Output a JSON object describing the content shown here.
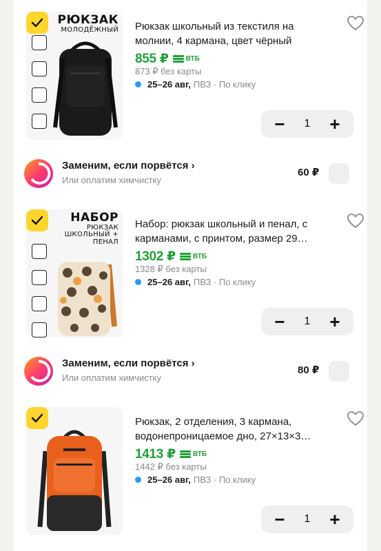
{
  "products": [
    {
      "title": "Рюкзак школьный из текстиля на молнии, 4 кармана, цвет чёрный",
      "price": "855 ₽",
      "bank": "ВТБ",
      "old_price": "873 ₽ без карты",
      "delivery_date": "25–26 авг,",
      "delivery_where": "ПВЗ · По клику",
      "quantity": "1",
      "minus": "−",
      "plus": "+",
      "promo_big": "РЮКЗАК",
      "promo_small": "МОЛОДЁЖНЫЙ",
      "bag_color": "#1a1a1a"
    },
    {
      "title": "Набор: рюкзак школьный и пенал, с карманами, с принтом, размер 29…",
      "price": "1302 ₽",
      "bank": "ВТБ",
      "old_price": "1328 ₽ без карты",
      "delivery_date": "25–26 авг,",
      "delivery_where": "ПВЗ · По клику",
      "quantity": "1",
      "minus": "−",
      "plus": "+",
      "promo_big": "НАБОР",
      "promo_small": "РЮКЗАК ШКОЛЬНЫЙ + ПЕНАЛ",
      "bag_color": "#e8c79a"
    },
    {
      "title": "Рюкзак, 2 отделения, 3 кармана, водонепроницаемое дно, 27×13×3…",
      "price": "1413 ₽",
      "bank": "ВТБ",
      "old_price": "1442 ₽ без карты",
      "delivery_date": "25–26 авг,",
      "delivery_where": "ПВЗ · По клику",
      "quantity": "1",
      "minus": "−",
      "plus": "+",
      "promo_big": "",
      "promo_small": "",
      "bag_color": "#e8601c"
    }
  ],
  "insurance": [
    {
      "title": "Заменим, если порвётся ›",
      "subtitle": "Или оплатим химчистку",
      "price": "60 ₽"
    },
    {
      "title": "Заменим, если порвётся ›",
      "subtitle": "Или оплатим химчистку",
      "price": "80 ₽"
    }
  ],
  "colors": {
    "price_green": "#21a038",
    "check_yellow": "#ffd52e",
    "dot_blue": "#2b9bf4",
    "bg": "#f3f1ee"
  }
}
